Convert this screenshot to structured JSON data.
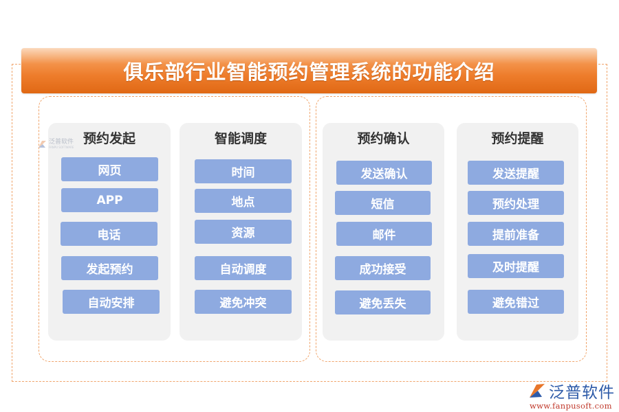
{
  "title": "俱乐部行业智能预约管理系统的功能介绍",
  "colors": {
    "banner_orange": "#ee7d2c",
    "dashed_border": "#f0a46a",
    "card_bg": "#f1f1f1",
    "item_blue": "#8eaae0",
    "item_text": "#ffffff",
    "card_title": "#333333"
  },
  "groups": [
    {
      "cards": [
        {
          "title": "预约发起",
          "items": [
            "网页",
            "APP",
            "电话",
            "发起预约",
            "自动安排"
          ]
        },
        {
          "title": "智能调度",
          "items": [
            "时间",
            "地点",
            "资源",
            "自动调度",
            "避免冲突"
          ]
        }
      ]
    },
    {
      "cards": [
        {
          "title": "预约确认",
          "items": [
            "发送确认",
            "短信",
            "邮件",
            "成功接受",
            "避免丢失"
          ]
        },
        {
          "title": "预约提醒",
          "items": [
            "发送提醒",
            "预约处理",
            "提前准备",
            "及时提醒",
            "避免错过"
          ]
        }
      ]
    }
  ],
  "watermark": {
    "text": "泛普软件",
    "subtext": "FANPU SOFTWARE",
    "icon": "fanpu-logo-icon"
  },
  "logo": {
    "text": "泛普软件",
    "url": "www.fanpusoft.com",
    "icon": "fanpu-logo-icon"
  }
}
